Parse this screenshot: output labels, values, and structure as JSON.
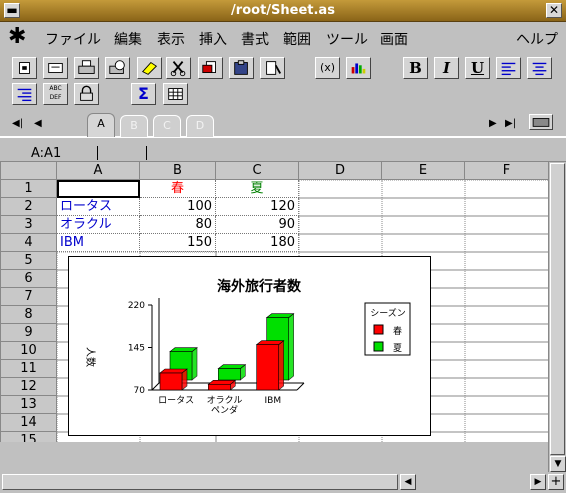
{
  "window": {
    "title": "/root/Sheet.as",
    "minimize": "▬",
    "close": "✕"
  },
  "menu": {
    "logo": "✱",
    "items": [
      "ファイル",
      "編集",
      "表示",
      "挿入",
      "書式",
      "範囲",
      "ツール",
      "画面"
    ],
    "help": "ヘルプ"
  },
  "toolbar": {
    "spell_label": "ABC DEF",
    "function_label": "(x)",
    "bold_label": "B",
    "italic_label": "I",
    "underline_label": "U",
    "sum_label": "Σ"
  },
  "tabs": [
    "A",
    "B",
    "C",
    "D"
  ],
  "nav": {
    "first": "◀|",
    "prev": "◀",
    "next": "▶",
    "last": "▶|"
  },
  "cell_reference": "A:A1",
  "columns": [
    "A",
    "B",
    "C",
    "D",
    "E",
    "F"
  ],
  "rows": [
    "1",
    "2",
    "3",
    "4",
    "5",
    "6",
    "7",
    "8",
    "9",
    "10",
    "11",
    "12",
    "13",
    "14",
    "15"
  ],
  "cells": {
    "b1": "春",
    "c1": "夏",
    "a2": "ロータス",
    "b2": "100",
    "c2": "120",
    "a3": "オラクル",
    "b3": "80",
    "c3": "90",
    "a4": "IBM",
    "b4": "150",
    "c4": "180"
  },
  "colors": {
    "spring": "#ff0000",
    "summer": "#00e000",
    "label_blue": "#0000cc",
    "c1_green": "#008000"
  },
  "chart_data": {
    "type": "bar",
    "title": "海外旅行者数",
    "ylabel": "人数",
    "categories": [
      "ロータス",
      "オラクル\nペンダ",
      "IBM"
    ],
    "category_lines": [
      [
        "ロータス"
      ],
      [
        "オラクル",
        "ペンダ"
      ],
      [
        "IBM"
      ]
    ],
    "series": [
      {
        "name": "春",
        "values": [
          100,
          80,
          150
        ],
        "color": "#ff0000"
      },
      {
        "name": "夏",
        "values": [
          120,
          90,
          180
        ],
        "color": "#00e000"
      }
    ],
    "yticks": [
      "220",
      "145",
      "70"
    ],
    "ylim": [
      70,
      220
    ],
    "legend_title": "シーズン",
    "legend_position": "right"
  }
}
